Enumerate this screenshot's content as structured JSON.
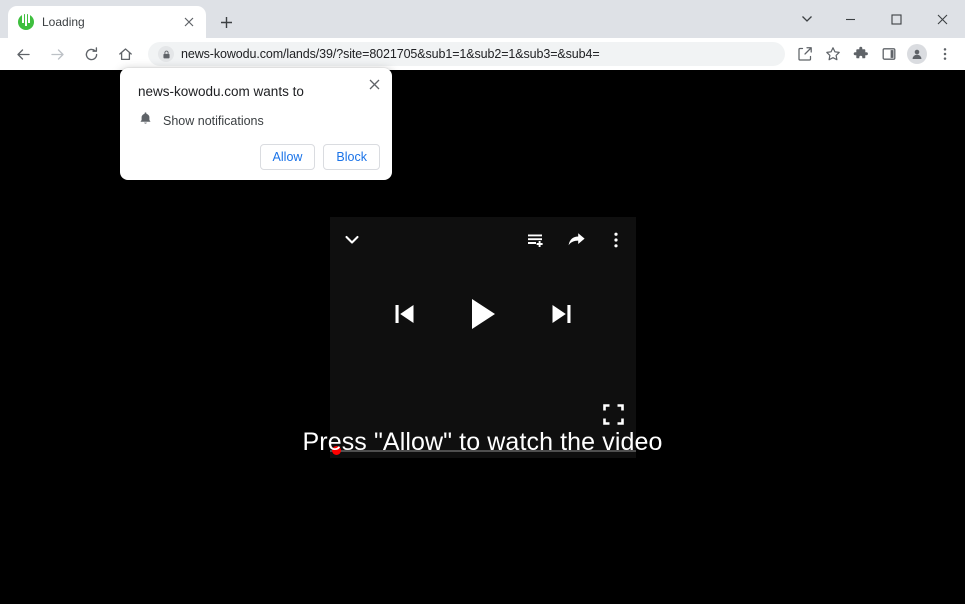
{
  "window": {
    "controls": {
      "tab_search": "tab-search",
      "minimize": "minimize",
      "maximize": "maximize",
      "close": "close"
    }
  },
  "tabstrip": {
    "tabs": [
      {
        "title": "Loading",
        "favicon_color": "#3fbf3f",
        "close_label": "Close tab"
      }
    ],
    "new_tab_label": "New tab"
  },
  "toolbar": {
    "back": "Back",
    "forward": "Forward",
    "reload": "Reload",
    "home": "Home",
    "url_domain": "news-kowodu.com",
    "url_path": "/lands/39/?site=8021705&sub1=1&sub2=1&sub3=&sub4=",
    "url_full": "news-kowodu.com/lands/39/?site=8021705&sub1=1&sub2=1&sub3=&sub4=",
    "share": "Share this page",
    "bookmark": "Bookmark this tab",
    "extensions": "Extensions",
    "side_panel": "Side panel",
    "profile": "Profile",
    "menu": "Customize and control Google Chrome"
  },
  "permission_dialog": {
    "title": "news-kowodu.com wants to",
    "request": "Show notifications",
    "allow_label": "Allow",
    "block_label": "Block",
    "close_label": "Close"
  },
  "player": {
    "collapse": "Collapse",
    "add_to_queue": "Add to queue",
    "share": "Share",
    "more": "More options",
    "previous": "Previous",
    "play": "Play",
    "next": "Next",
    "fullscreen": "Fullscreen",
    "progress_percent": 0,
    "accent_color": "#ff0000",
    "background_color": "#0f0f0f"
  },
  "content": {
    "headline": "Press \"Allow\" to watch the video",
    "background_color": "#000000"
  }
}
